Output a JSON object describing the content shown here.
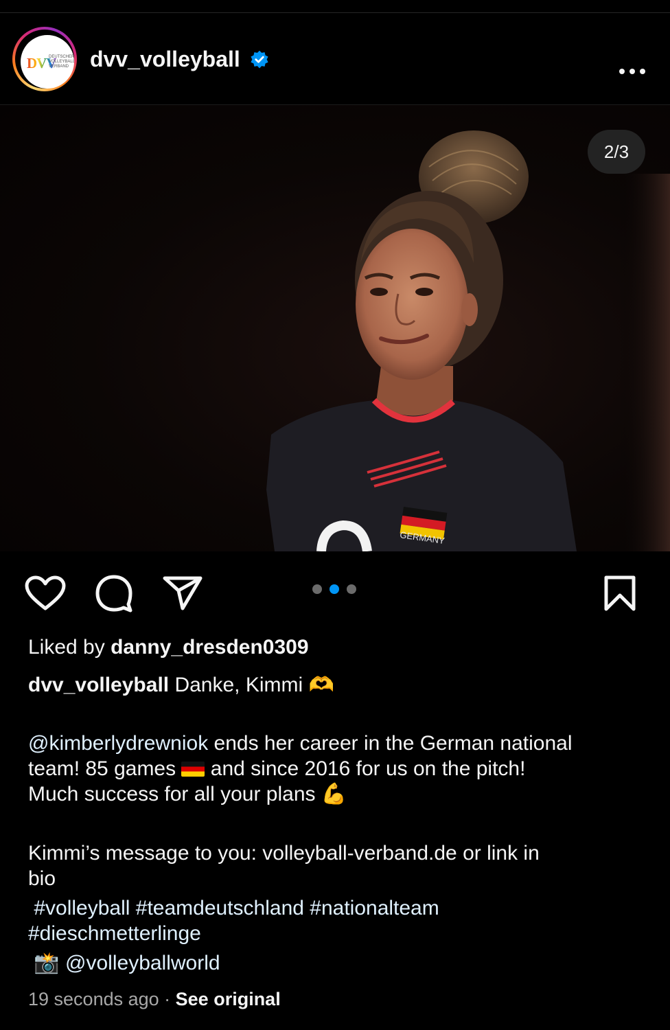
{
  "post": {
    "username": "dvv_volleyball",
    "avatar_logo_text": "DVV",
    "avatar_logo_subtext": "DEUTSCHER VOLLEYBALL VERBAND",
    "verified_icon": "verified-badge-icon",
    "more_icon": "more-horizontal-icon",
    "carousel_counter": "2/3",
    "carousel_total": 3,
    "carousel_active_index": 2,
    "photo_jersey_text": "GERMANY"
  },
  "actions": {
    "like_icon": "heart-outline-icon",
    "comment_icon": "comment-bubble-icon",
    "share_icon": "paper-plane-icon",
    "save_icon": "bookmark-outline-icon"
  },
  "likes": {
    "prefix": "Liked by ",
    "user": "danny_dresden0309"
  },
  "caption": {
    "username": "dvv_volleyball",
    "first_line": " Danke, Kimmi ",
    "first_line_emoji": "🫶",
    "mention": "@kimberlydrewniok",
    "p1_a": " ends her career in the German national",
    "p1_b_pre": "team! 85 games ",
    "p1_flag": "🇩🇪",
    "p1_b_post": " and since 2016 for us on the pitch!",
    "p1_c": "Much success for all your plans ",
    "p1_c_emoji": "💪",
    "p2_a": "Kimmi’s message to you: volleyball-verband.de or link in",
    "p2_b": "bio",
    "hashtags_line1": "#volleyball #teamdeutschland #nationalteam",
    "hashtags_line2": "#dieschmetterlinge",
    "camera_emoji": "📸",
    "credit": " @volleyballworld"
  },
  "footer": {
    "time": "19 seconds ago",
    "separator": " · ",
    "see_original": "See original"
  },
  "colors": {
    "background": "#000000",
    "text": "#f5f5f5",
    "muted": "#a8a8a8",
    "accent_blue": "#0095f6",
    "link_text": "#e0f1ff"
  }
}
